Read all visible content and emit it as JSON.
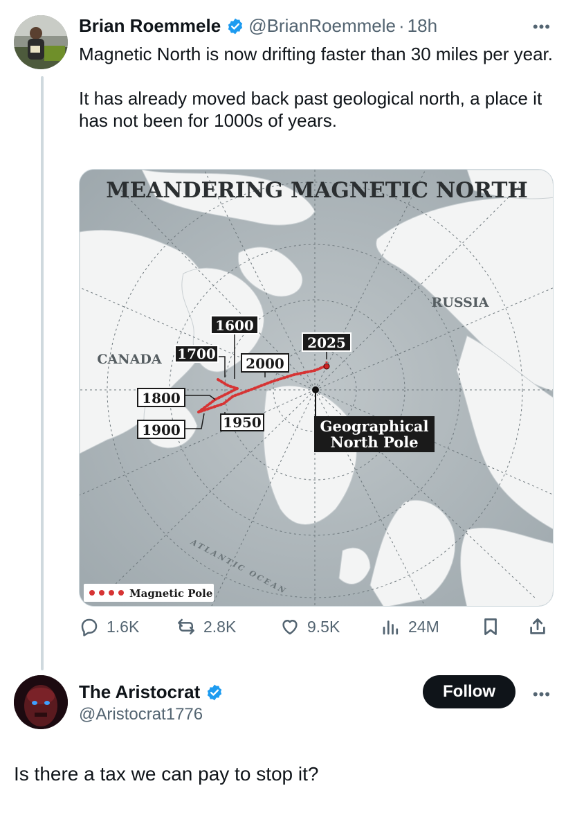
{
  "tweet1": {
    "author_name": "Brian Roemmele",
    "author_handle": "@BrianRoemmele",
    "separator": "·",
    "time": "18h",
    "more_icon": "more-horizontal-icon",
    "text_paragraphs": [
      "Magnetic North is now drifting faster than 30 miles per year.",
      "It has already moved back past geological north, a place it has not been for 1000s of years."
    ],
    "media": {
      "title": "MEANDERING MAGNETIC NORTH",
      "region_labels": {
        "canada": "CANADA",
        "russia": "RUSSIA",
        "ocean": "ATLANTIC OCEAN"
      },
      "year_labels": [
        "1600",
        "1700",
        "1800",
        "1900",
        "1950",
        "2000",
        "2025"
      ],
      "pole_label_line1": "Geographical",
      "pole_label_line2": "North Pole",
      "legend_label": "Magnetic Pole",
      "colors": {
        "land": "#f3f4f4",
        "ocean": "#a6b0b4",
        "path": "#d63434"
      }
    },
    "actions": {
      "replies": {
        "icon": "reply-icon",
        "count": "1.6K"
      },
      "reposts": {
        "icon": "repost-icon",
        "count": "2.8K"
      },
      "likes": {
        "icon": "heart-icon",
        "count": "9.5K"
      },
      "views": {
        "icon": "views-icon",
        "count": "24M"
      },
      "bookmark": {
        "icon": "bookmark-icon"
      },
      "share": {
        "icon": "share-icon"
      }
    }
  },
  "tweet2": {
    "author_name": "The Aristocrat",
    "author_handle": "@Aristocrat1776",
    "follow_label": "Follow",
    "more_icon": "more-horizontal-icon",
    "text": "Is there a tax we can pay to stop it?"
  },
  "colors": {
    "accent": "#1d9bf0",
    "text": "#0f1419",
    "muted": "#536471"
  }
}
